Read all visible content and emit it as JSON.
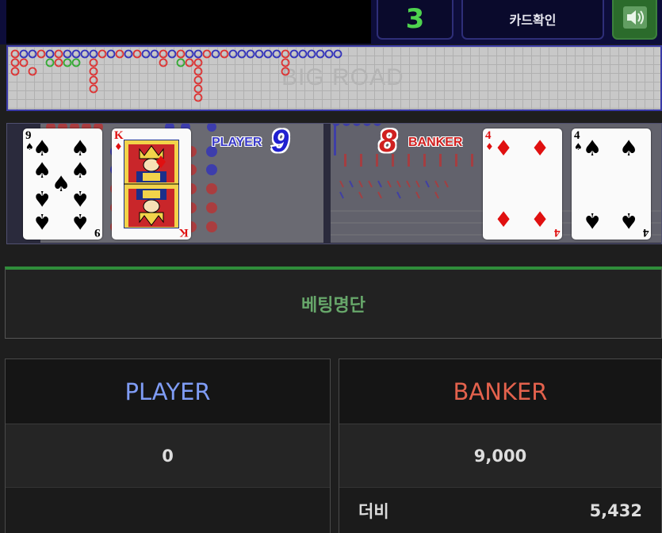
{
  "round_number": "3",
  "card_check_label": "카드확인",
  "sound_icon": "speaker-icon",
  "big_road_label": "BIG ROAD",
  "cards": {
    "player": [
      {
        "rank": "9",
        "suit": "♠",
        "color": "black"
      },
      {
        "rank": "K",
        "suit": "♦",
        "color": "red"
      }
    ],
    "banker": [
      {
        "rank": "4",
        "suit": "♦",
        "color": "red"
      },
      {
        "rank": "4",
        "suit": "♠",
        "color": "black"
      }
    ]
  },
  "player_label": "PLAYER",
  "player_score": "9",
  "banker_label": "BANKER",
  "banker_score": "8",
  "bet_list_title": "베팅명단",
  "columns": {
    "player": {
      "title": "PLAYER",
      "total": "0",
      "bets": []
    },
    "banker": {
      "title": "BANKER",
      "total": "9,000",
      "bets": [
        {
          "name": "더비",
          "amount": "5,432"
        }
      ]
    }
  },
  "colors": {
    "player": "#7f9cf5",
    "banker": "#e4624d",
    "round": "#4ed34e",
    "accent_green": "#2f8d3a"
  }
}
